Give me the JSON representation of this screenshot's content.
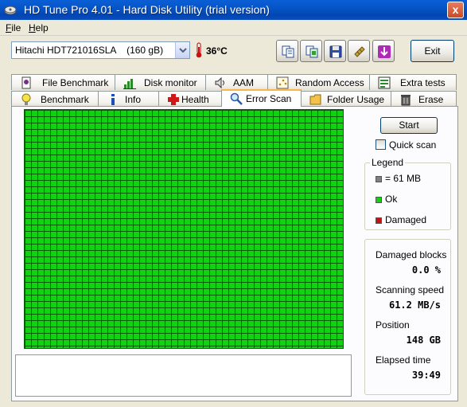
{
  "window": {
    "title": "HD Tune Pro 4.01 - Hard Disk Utility (trial version)",
    "close_label": "x"
  },
  "menu": [
    {
      "label": "File",
      "mnemonic": "F",
      "rest": "ile"
    },
    {
      "label": "Help",
      "mnemonic": "H",
      "rest": "elp"
    }
  ],
  "toolbar": {
    "drive": "Hitachi HDT721016SLA    (160 gB)",
    "temperature": "36°C",
    "buttons": [
      {
        "name": "copy-text-button",
        "icon": "copy-text-icon"
      },
      {
        "name": "copy-screenshot-button",
        "icon": "copy-screenshot-icon"
      },
      {
        "name": "save-screenshot-button",
        "icon": "floppy-disk-icon"
      },
      {
        "name": "options-button",
        "icon": "options-icon"
      },
      {
        "name": "download-button",
        "icon": "download-arrow-icon"
      }
    ],
    "exit_label": "Exit"
  },
  "tabs_top": [
    {
      "label": "File Benchmark",
      "icon": "file-benchmark-icon"
    },
    {
      "label": "Disk monitor",
      "icon": "disk-monitor-icon"
    },
    {
      "label": "AAM",
      "icon": "speaker-icon"
    },
    {
      "label": "Random Access",
      "icon": "random-access-icon"
    },
    {
      "label": "Extra tests",
      "icon": "extra-tests-icon"
    }
  ],
  "tabs_bottom": [
    {
      "label": "Benchmark",
      "icon": "lightbulb-icon"
    },
    {
      "label": "Info",
      "icon": "info-icon"
    },
    {
      "label": "Health",
      "icon": "health-cross-icon"
    },
    {
      "label": "Error Scan",
      "icon": "magnifier-icon",
      "active": true
    },
    {
      "label": "Folder Usage",
      "icon": "folder-icon"
    },
    {
      "label": "Erase",
      "icon": "trash-icon"
    }
  ],
  "scan": {
    "start_label": "Start",
    "quick_scan_label": "Quick scan",
    "quick_scan_checked": false,
    "grid_color": "#10d210"
  },
  "legend": {
    "title": "Legend",
    "items": [
      {
        "label": "= 61 MB",
        "color": "#808080"
      },
      {
        "label": "Ok",
        "color": "#10d210"
      },
      {
        "label": "Damaged",
        "color": "#c81010"
      }
    ]
  },
  "stats": {
    "damaged_blocks_label": "Damaged blocks",
    "damaged_blocks_value": "0.0 %",
    "scanning_speed_label": "Scanning speed",
    "scanning_speed_value": "61.2 MB/s",
    "position_label": "Position",
    "position_value": "148 GB",
    "elapsed_label": "Elapsed time",
    "elapsed_value": "39:49"
  }
}
